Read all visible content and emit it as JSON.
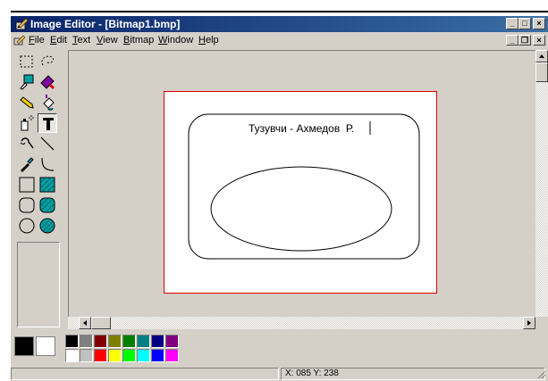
{
  "window": {
    "title": "Image Editor - [Bitmap1.bmp]",
    "caption_buttons": {
      "minimize": "_",
      "maximize": "□",
      "close": "×"
    },
    "mdi_buttons": {
      "minimize": "_",
      "restore": "❐",
      "close": "×"
    }
  },
  "menu": [
    {
      "label": "File",
      "underline": "F"
    },
    {
      "label": "Edit",
      "underline": "E"
    },
    {
      "label": "Text",
      "underline": "T"
    },
    {
      "label": "View",
      "underline": "V"
    },
    {
      "label": "Bitmap",
      "underline": "B"
    },
    {
      "label": "Window",
      "underline": "W"
    },
    {
      "label": "Help",
      "underline": "H"
    }
  ],
  "tools": [
    "select-rect",
    "select-lasso",
    "pick-color",
    "eraser",
    "pencil",
    "fill",
    "airbrush",
    "text",
    "brush",
    "line",
    "dropper",
    "curve",
    "rectangle",
    "filled-rectangle",
    "rounded-rectangle",
    "filled-rounded-rectangle",
    "ellipse",
    "filled-ellipse"
  ],
  "selected_tool": "text",
  "canvas": {
    "text": "Тузувчи - Ахмедов  Р.",
    "border_color": "#e00000"
  },
  "palette": {
    "foreground": "#000000",
    "background": "#ffffff",
    "row1": [
      "#000000",
      "#808080",
      "#800000",
      "#808000",
      "#008000",
      "#008080",
      "#000080",
      "#800080"
    ],
    "row2": [
      "#ffffff",
      "#c0c0c0",
      "#ff0000",
      "#ffff00",
      "#00ff00",
      "#00ffff",
      "#0000ff",
      "#ff00ff"
    ]
  },
  "status": {
    "coords": "X: 085  Y: 238"
  }
}
